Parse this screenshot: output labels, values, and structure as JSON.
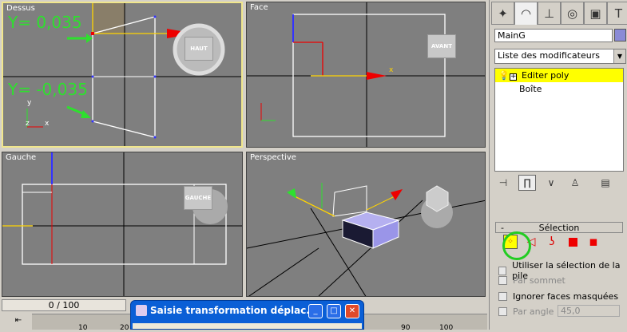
{
  "viewports": {
    "top": {
      "title": "Dessus",
      "cube": "HAUT",
      "annot_upper": "Y= 0,035",
      "annot_lower": "Y= -0,035"
    },
    "front": {
      "title": "Face",
      "cube": "AVANT"
    },
    "left": {
      "title": "Gauche",
      "cube": "GAUCHE"
    },
    "persp": {
      "title": "Perspective"
    }
  },
  "axis": {
    "x": "x",
    "y": "y",
    "z": "z"
  },
  "panel": {
    "object_name": "MainG",
    "modifier_list": "Liste des modificateurs",
    "stack": [
      {
        "label": "Editer poly",
        "selected": true
      },
      {
        "label": "Boîte",
        "selected": false
      }
    ],
    "rollout_title": "Sélection",
    "checks": [
      {
        "label": "Utiliser la sélection de la pile",
        "disabled": false
      },
      {
        "label": "Par sommet",
        "disabled": true
      },
      {
        "label": "Ignorer faces masquées",
        "disabled": false
      },
      {
        "label": "Par angle :",
        "disabled": true
      }
    ],
    "angle_value": "45,0",
    "minus": "-"
  },
  "timeline": {
    "frame": "0 / 100",
    "ticks": [
      "10",
      "20",
      "90",
      "100"
    ]
  },
  "dialog": {
    "title": "Saisie transformation déplac..."
  },
  "icons": {
    "tab1": "create-icon",
    "tab2": "modify-icon",
    "tab3": "hierarchy-icon",
    "tab4": "motion-icon",
    "tab5": "display-icon",
    "tab6": "utilities-icon"
  },
  "colors": {
    "selection_yellow": "#ffff00",
    "annotation_green": "#2ee02e",
    "active_border": "#f0e68c"
  }
}
